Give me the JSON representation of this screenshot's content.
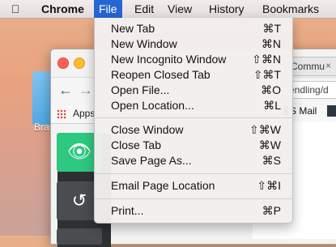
{
  "menubar": {
    "apple_icon": "",
    "app_name": "Chrome",
    "items": [
      "File",
      "Edit",
      "View",
      "History",
      "Bookmarks"
    ]
  },
  "desktop": {
    "folder_label": "Bra"
  },
  "browser": {
    "bookmarks_apps_label": "Apps",
    "tab_title": "Commu",
    "tab_close": "×",
    "url_fragment": "endling/d",
    "bookmark_mail": "S Mail",
    "eye_icon": "eye-icon",
    "undo_icon": "undo-icon"
  },
  "file_menu": {
    "items": [
      {
        "label": "New Tab",
        "shortcut": "⌘T"
      },
      {
        "label": "New Window",
        "shortcut": "⌘N"
      },
      {
        "label": "New Incognito Window",
        "shortcut": "⇧⌘N"
      },
      {
        "label": "Reopen Closed Tab",
        "shortcut": "⇧⌘T"
      },
      {
        "label": "Open File...",
        "shortcut": "⌘O"
      },
      {
        "label": "Open Location...",
        "shortcut": "⌘L"
      },
      {
        "label": "Close Window",
        "shortcut": "⇧⌘W"
      },
      {
        "label": "Close Tab",
        "shortcut": "⌘W"
      },
      {
        "label": "Save Page As...",
        "shortcut": "⌘S"
      },
      {
        "label": "Email Page Location",
        "shortcut": "⇧⌘I"
      },
      {
        "label": "Print...",
        "shortcut": "⌘P"
      }
    ]
  },
  "colors": {
    "menu_highlight": "#2566d3",
    "eye_button": "#2ec880"
  }
}
